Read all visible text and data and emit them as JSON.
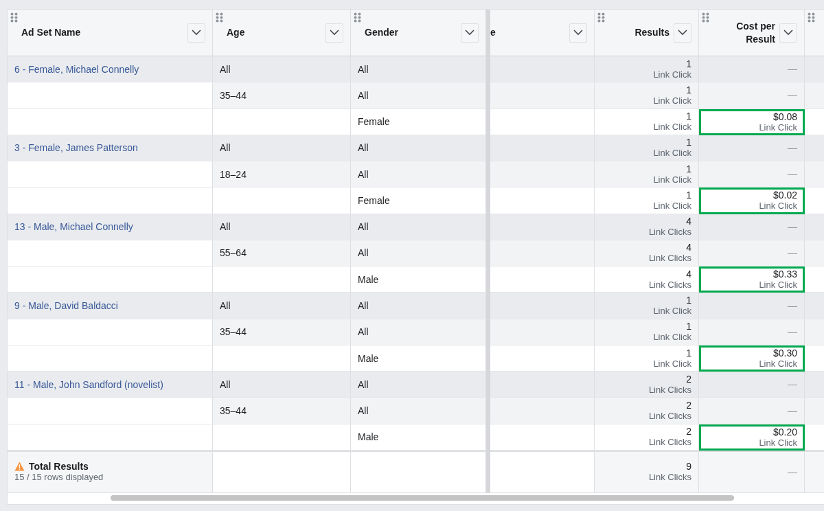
{
  "table": {
    "columns": [
      {
        "label": "Ad Set Name",
        "kind": "text",
        "handle": true,
        "menu": true
      },
      {
        "label": "Age",
        "kind": "text",
        "handle": true,
        "menu": true
      },
      {
        "label": "Gender",
        "kind": "text",
        "handle": true,
        "menu": true
      },
      {
        "label": "e",
        "kind": "text",
        "handle": false,
        "menu": true
      },
      {
        "label": "Results",
        "kind": "number",
        "handle": true,
        "menu": true
      },
      {
        "label": "Cost per Result",
        "kind": "number",
        "handle": true,
        "menu": true
      },
      {
        "kind": "text",
        "handle": true,
        "menu": false
      }
    ],
    "rows": [
      {
        "kind": "adset",
        "name": "6 - Female, Michael Connelly",
        "age": "All",
        "gender": "All",
        "results": "1",
        "results_unit": "Link Click",
        "cost": "—",
        "highlighted": false
      },
      {
        "kind": "age",
        "age": "35–44",
        "gender": "All",
        "results": "1",
        "results_unit": "Link Click",
        "cost": "—",
        "highlighted": false
      },
      {
        "kind": "gender",
        "gender": "Female",
        "results": "1",
        "results_unit": "Link Click",
        "cost": "$0.08",
        "cost_unit": "Link Click",
        "highlighted": true
      },
      {
        "kind": "adset",
        "name": "3 - Female, James Patterson",
        "age": "All",
        "gender": "All",
        "results": "1",
        "results_unit": "Link Click",
        "cost": "—",
        "highlighted": false
      },
      {
        "kind": "age",
        "age": "18–24",
        "gender": "All",
        "results": "1",
        "results_unit": "Link Click",
        "cost": "—",
        "highlighted": false
      },
      {
        "kind": "gender",
        "gender": "Female",
        "results": "1",
        "results_unit": "Link Click",
        "cost": "$0.02",
        "cost_unit": "Link Click",
        "highlighted": true
      },
      {
        "kind": "adset",
        "name": "13 - Male, Michael Connelly",
        "age": "All",
        "gender": "All",
        "results": "4",
        "results_unit": "Link Clicks",
        "cost": "—",
        "highlighted": false
      },
      {
        "kind": "age",
        "age": "55–64",
        "gender": "All",
        "results": "4",
        "results_unit": "Link Clicks",
        "cost": "—",
        "highlighted": false
      },
      {
        "kind": "gender",
        "gender": "Male",
        "results": "4",
        "results_unit": "Link Clicks",
        "cost": "$0.33",
        "cost_unit": "Link Click",
        "highlighted": true
      },
      {
        "kind": "adset",
        "name": "9 - Male, David Baldacci",
        "age": "All",
        "gender": "All",
        "results": "1",
        "results_unit": "Link Click",
        "cost": "—",
        "highlighted": false
      },
      {
        "kind": "age",
        "age": "35–44",
        "gender": "All",
        "results": "1",
        "results_unit": "Link Click",
        "cost": "—",
        "highlighted": false
      },
      {
        "kind": "gender",
        "gender": "Male",
        "results": "1",
        "results_unit": "Link Click",
        "cost": "$0.30",
        "cost_unit": "Link Click",
        "highlighted": true
      },
      {
        "kind": "adset",
        "name": "11 - Male, John Sandford (novelist)",
        "age": "All",
        "gender": "All",
        "results": "2",
        "results_unit": "Link Clicks",
        "cost": "—",
        "highlighted": false
      },
      {
        "kind": "age",
        "age": "35–44",
        "gender": "All",
        "results": "2",
        "results_unit": "Link Clicks",
        "cost": "—",
        "highlighted": false
      },
      {
        "kind": "gender",
        "gender": "Male",
        "results": "2",
        "results_unit": "Link Clicks",
        "cost": "$0.20",
        "cost_unit": "Link Click",
        "highlighted": true
      }
    ],
    "footer": {
      "title": "Total Results",
      "subtitle": "15 / 15 rows displayed",
      "results": "9",
      "results_unit": "Link Clicks",
      "cost": "—"
    }
  }
}
